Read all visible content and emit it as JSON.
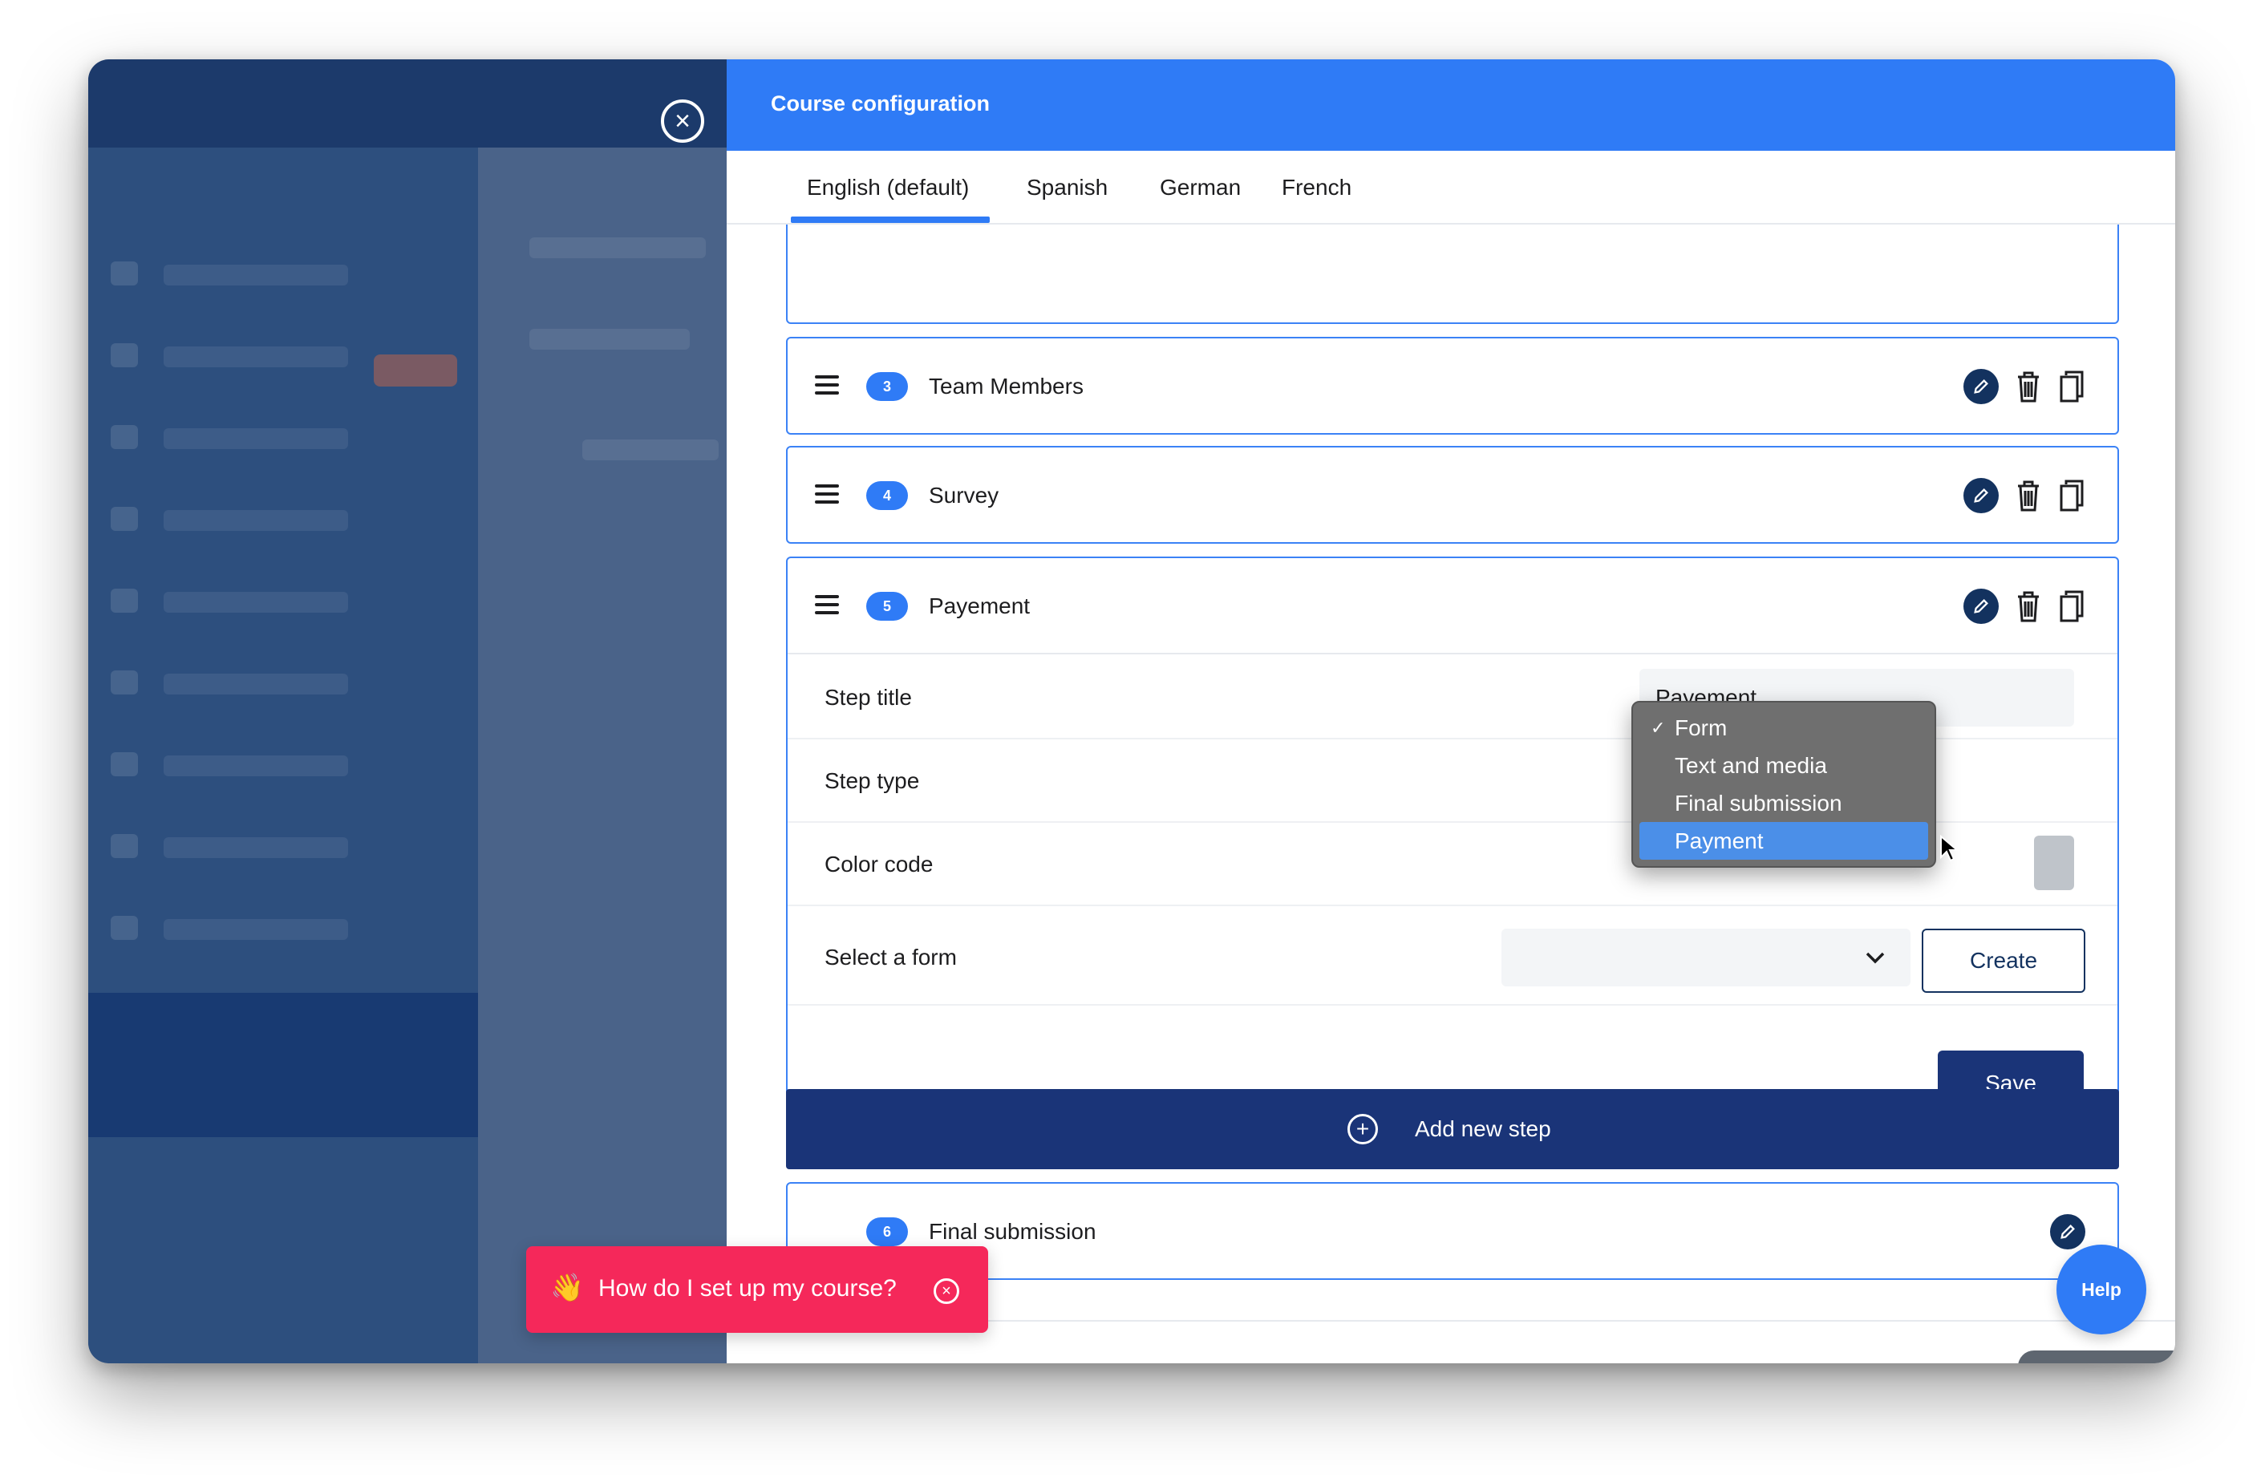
{
  "panel": {
    "title": "Course configuration"
  },
  "tabs": [
    {
      "label": "English (default)"
    },
    {
      "label": "Spanish"
    },
    {
      "label": "German"
    },
    {
      "label": "French"
    }
  ],
  "steps": [
    {
      "number": "3",
      "name": "Team Members"
    },
    {
      "number": "4",
      "name": "Survey"
    },
    {
      "number": "5",
      "name": "Payement"
    },
    {
      "number": "6",
      "name": "Final submission"
    }
  ],
  "editor": {
    "step_title_label": "Step title",
    "step_title_value": "Payement",
    "step_type_label": "Step type",
    "color_code_label": "Color code",
    "select_form_label": "Select a form",
    "create_label": "Create",
    "save_label": "Save"
  },
  "dropdown": {
    "checked": "✓",
    "options": [
      "Form",
      "Text and media",
      "Final submission",
      "Payment"
    ]
  },
  "add_step_label": "Add new step",
  "toast": {
    "emoji": "👋",
    "text": "How do I set up my course?"
  },
  "help_label": "Help",
  "colors": {
    "accent": "#2f7bf6",
    "navy": "#1a3478",
    "toast": "#f5285a"
  }
}
